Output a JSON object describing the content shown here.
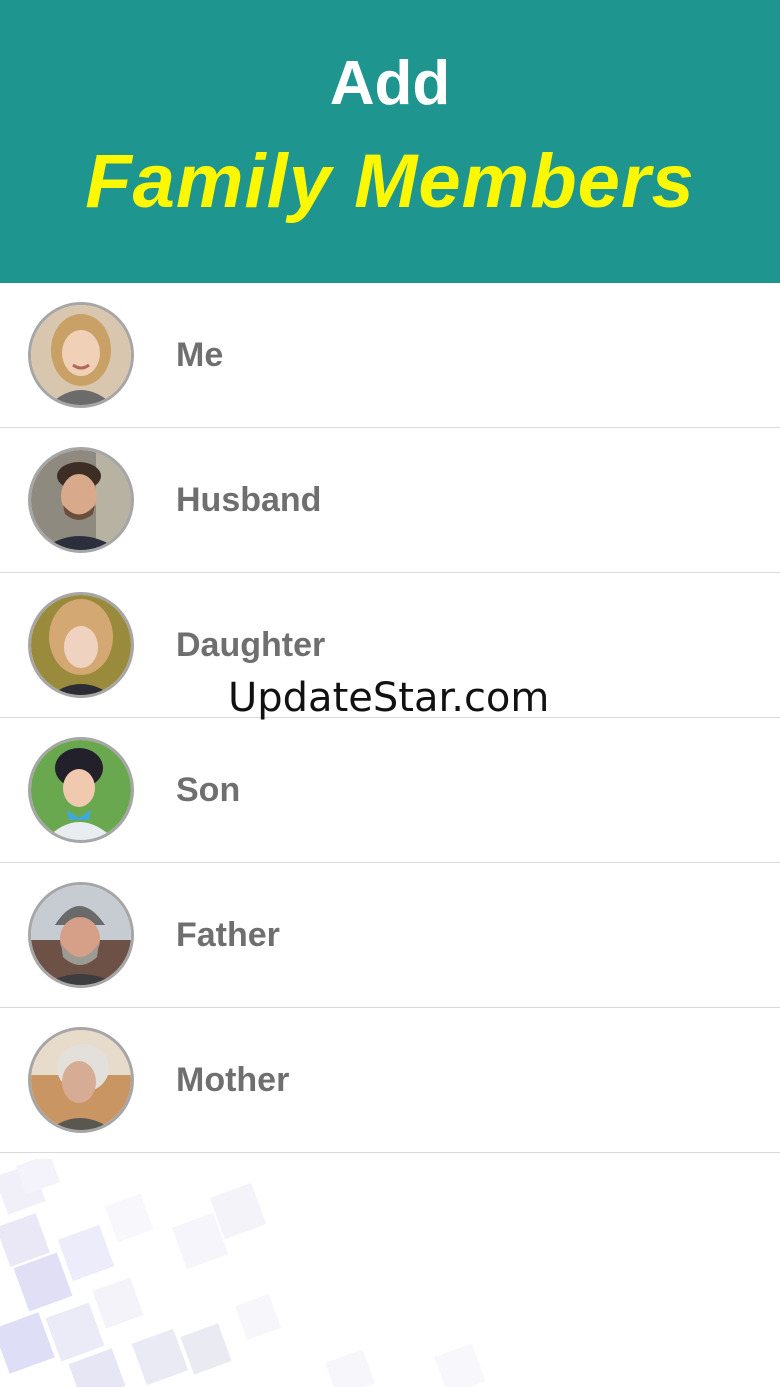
{
  "header": {
    "title_line1": "Add",
    "title_line2": "Family Members",
    "background_color": "#1f958f",
    "title_line2_color": "#fcf702"
  },
  "members": [
    {
      "label": "Me",
      "avatar": "woman-photo-avatar"
    },
    {
      "label": "Husband",
      "avatar": "man-photo-avatar"
    },
    {
      "label": "Daughter",
      "avatar": "girl-photo-avatar"
    },
    {
      "label": "Son",
      "avatar": "boy-photo-avatar"
    },
    {
      "label": "Father",
      "avatar": "older-man-photo-avatar"
    },
    {
      "label": "Mother",
      "avatar": "older-woman-photo-avatar"
    }
  ],
  "watermark": "UpdateStar.com"
}
